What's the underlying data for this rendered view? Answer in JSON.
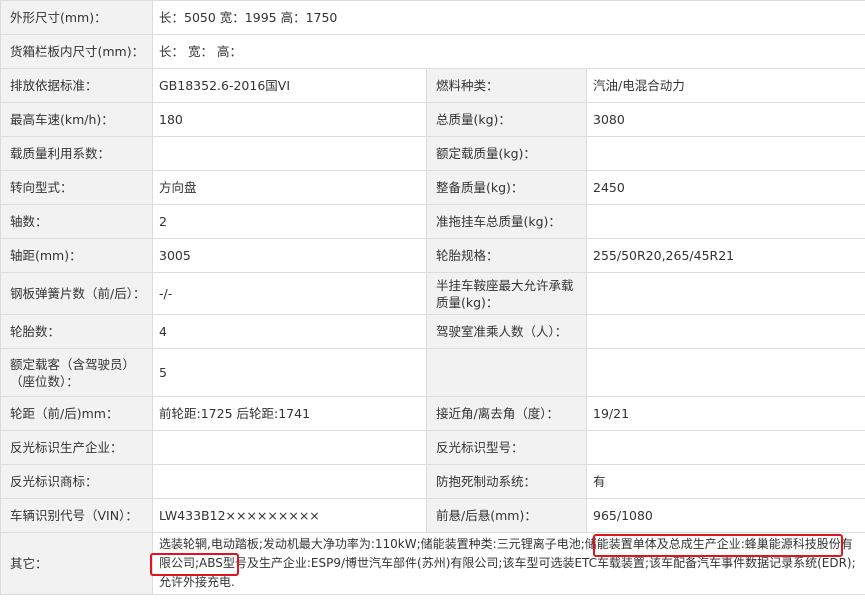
{
  "rows": [
    {
      "label": "外形尺寸(mm)：",
      "value": "长：5050 宽：1995 高：1750"
    },
    {
      "label": "货箱栏板内尺寸(mm)：",
      "value": "长： 宽： 高："
    },
    {
      "l1": "排放依据标准：",
      "v1": "GB18352.6-2016国VI",
      "l2": "燃料种类：",
      "v2": "汽油/电混合动力"
    },
    {
      "l1": "最高车速(km/h)：",
      "v1": "180",
      "l2": "总质量(kg)：",
      "v2": "3080"
    },
    {
      "l1": "载质量利用系数：",
      "v1": "",
      "l2": "额定载质量(kg)：",
      "v2": ""
    },
    {
      "l1": "转向型式：",
      "v1": "方向盘",
      "l2": "整备质量(kg)：",
      "v2": "2450"
    },
    {
      "l1": "轴数：",
      "v1": "2",
      "l2": "准拖挂车总质量(kg)：",
      "v2": ""
    },
    {
      "l1": "轴距(mm)：",
      "v1": "3005",
      "l2": "轮胎规格：",
      "v2": "255/50R20,265/45R21"
    },
    {
      "l1": "钢板弹簧片数（前/后）：",
      "v1": "-/-",
      "l2": "半挂车鞍座最大允许承载质量(kg)：",
      "v2": ""
    },
    {
      "l1": "轮胎数：",
      "v1": "4",
      "l2": "驾驶室准乘人数（人）：",
      "v2": ""
    },
    {
      "l1": "额定载客（含驾驶员）（座位数）：",
      "v1": "5",
      "l2": "",
      "v2": ""
    },
    {
      "l1": "轮距（前/后)mm：",
      "v1": "前轮距:1725 后轮距:1741",
      "l2": "接近角/离去角（度）：",
      "v2": "19/21"
    },
    {
      "l1": "反光标识生产企业：",
      "v1": "",
      "l2": "反光标识型号：",
      "v2": ""
    },
    {
      "l1": "反光标识商标：",
      "v1": "",
      "l2": "防抱死制动系统：",
      "v2": "有"
    },
    {
      "l1": "车辆识别代号（VIN）：",
      "v1": "LW433B12×××××××××",
      "l2": "前悬/后悬(mm)：",
      "v2": "965/1080"
    }
  ],
  "other": {
    "label": "其它：",
    "text": "选装轮辋,电动踏板;发动机最大净功率为:110kW;储能装置种类:三元锂离子电池;储能装置单体及总成生产企业:蜂巢能源科技股份有限公司;ABS型号及生产企业:ESP9/博世汽车部件(苏州)有限公司;该车型可选装ETC车载装置;该车配备汽车事件数据记录系统(EDR);允许外接充电."
  }
}
